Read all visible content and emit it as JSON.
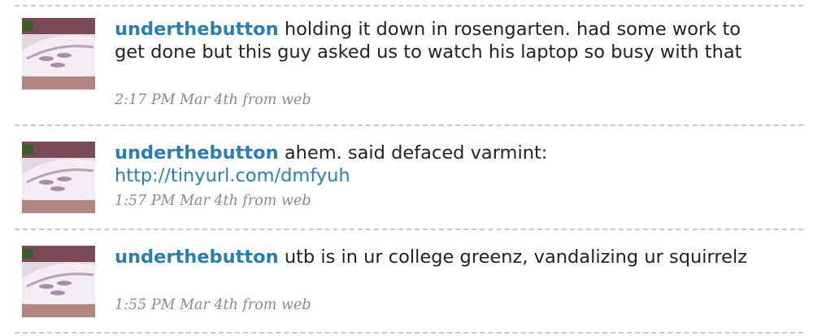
{
  "timeline": {
    "tweets": [
      {
        "username": "underthebutton",
        "text": "holding it down in rosengarten. had some work to get done but this guy asked us to watch his laptop so busy with that",
        "link": "",
        "timestamp": "2:17 PM Mar 4th",
        "source_prefix": "from",
        "source": "web"
      },
      {
        "username": "underthebutton",
        "text": "ahem. said defaced varmint:",
        "link": "http://tinyurl.com/dmfyuh",
        "timestamp": "1:57 PM Mar 4th",
        "source_prefix": "from",
        "source": "web"
      },
      {
        "username": "underthebutton",
        "text": "utb is in ur college greenz, vandalizing ur squirrelz",
        "link": "",
        "timestamp": "1:55 PM Mar 4th",
        "source_prefix": "from",
        "source": "web"
      }
    ]
  },
  "colors": {
    "username": "#2b7fb0",
    "link": "#2b7fb0",
    "text": "#222222",
    "meta": "#8a8a8a",
    "divider": "#c9c9c9"
  },
  "icons": {
    "avatar": "avatar-image"
  }
}
